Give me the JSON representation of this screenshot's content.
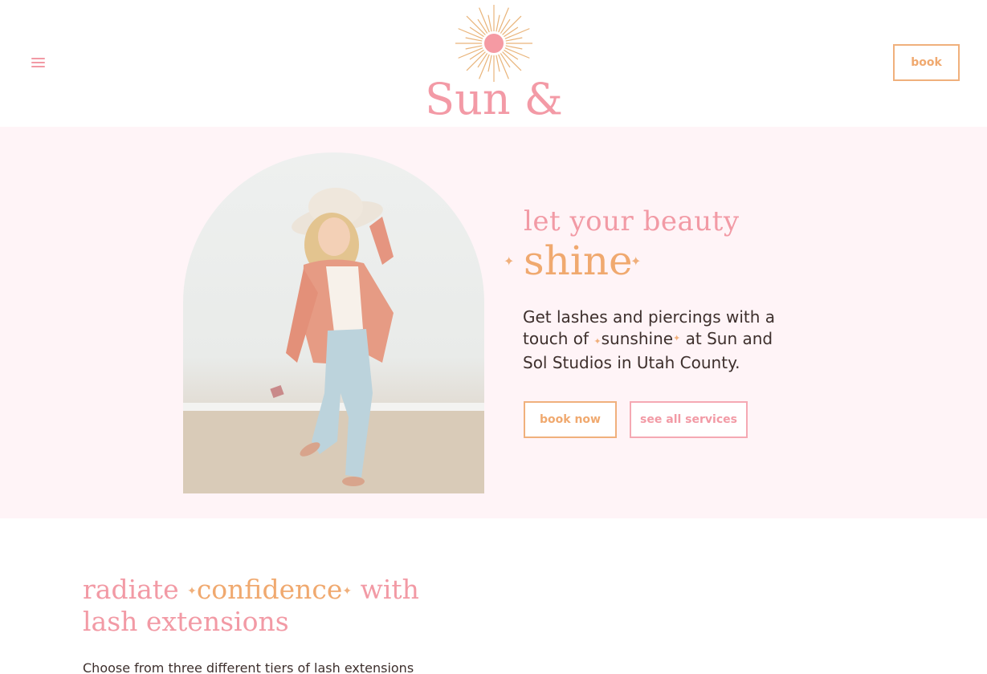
{
  "header": {
    "menu_icon": "hamburger-menu-icon",
    "logo_text": "Sun & Sol",
    "logo_icon": "sunburst-icon",
    "book_label": "book"
  },
  "hero": {
    "tagline_line1": "let your beauty",
    "tagline_line2": "shine",
    "body_part1": "Get lashes and piercings with a touch of ",
    "body_highlight": "sunshine",
    "body_part2": " at Sun and Sol Studios in Utah County.",
    "book_now_label": "book now",
    "services_label": "see all services",
    "sparkle_icon": "sparkle-icon"
  },
  "lash": {
    "heading_word1": "radiate",
    "heading_accent": "confidence",
    "heading_word2": "with",
    "heading_line2": "lash extensions",
    "body": "Choose from three different tiers of lash extensions"
  },
  "colors": {
    "pink": "#f29aa5",
    "peach": "#f0a96f",
    "hero_bg": "#fff4f7",
    "text": "#3d2f2c"
  }
}
